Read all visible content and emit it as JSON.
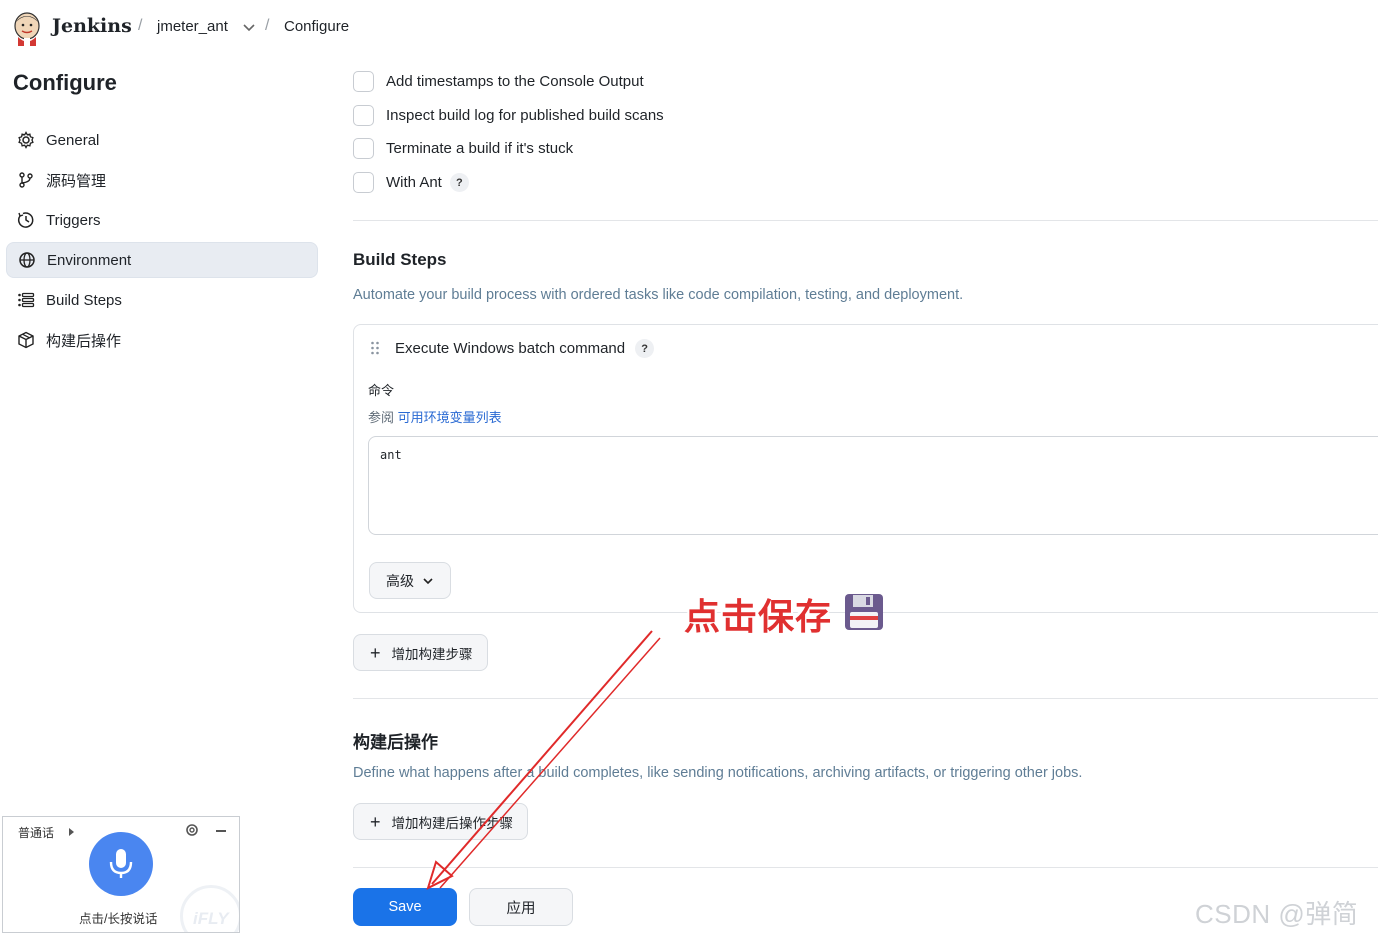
{
  "header": {
    "brand": "Jenkins",
    "breadcrumbs": [
      "jmeter_ant",
      "Configure"
    ],
    "separator": "/"
  },
  "sidebar": {
    "title": "Configure",
    "items": [
      {
        "label": "General",
        "icon": "gear-icon",
        "active": false
      },
      {
        "label": "源码管理",
        "icon": "branch-icon",
        "active": false
      },
      {
        "label": "Triggers",
        "icon": "clock-icon",
        "active": false
      },
      {
        "label": "Environment",
        "icon": "globe-icon",
        "active": true
      },
      {
        "label": "Build Steps",
        "icon": "list-icon",
        "active": false
      },
      {
        "label": "构建后操作",
        "icon": "cube-icon",
        "active": false
      }
    ]
  },
  "environment": {
    "options": [
      {
        "label": "Add timestamps to the Console Output",
        "checked": false
      },
      {
        "label": "Inspect build log for published build scans",
        "checked": false
      },
      {
        "label": "Terminate a build if it's stuck",
        "checked": false
      },
      {
        "label": "With Ant",
        "checked": false,
        "help": "?"
      }
    ]
  },
  "build_steps": {
    "title": "Build Steps",
    "description": "Automate your build process with ordered tasks like code compilation, testing, and deployment.",
    "step": {
      "title": "Execute Windows batch command",
      "help": "?",
      "field_label": "命令",
      "see_also_prefix": "参阅",
      "see_also_link": "可用环境变量列表",
      "command": "ant",
      "advanced_label": "高级"
    },
    "add_button": "增加构建步骤"
  },
  "post_build": {
    "title": "构建后操作",
    "description": "Define what happens after a build completes, like sending notifications, archiving artifacts, or triggering other jobs.",
    "add_button": "增加构建后操作步骤"
  },
  "actions": {
    "save": "Save",
    "apply": "应用"
  },
  "annotation": {
    "text": "点击保存"
  },
  "voice_widget": {
    "language": "普通话",
    "hint": "点击/长按说话",
    "watermark": "iFLY"
  },
  "watermark": "CSDN @弹简特",
  "colors": {
    "primary": "#1a73e8",
    "annotation": "#e03030",
    "link": "#2a6ad3",
    "desc": "#5f7d95",
    "active_bg": "#e8ecf2"
  }
}
